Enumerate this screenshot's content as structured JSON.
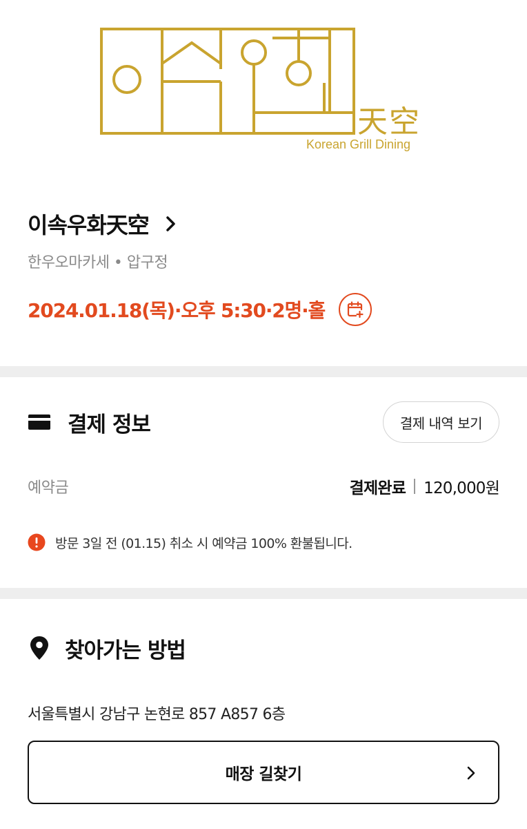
{
  "logo": {
    "hangul_mark": "이속우화",
    "hanja": "天空",
    "tagline": "Korean Grill Dining",
    "color": "#c9a42f"
  },
  "store": {
    "name": "이속우화天空",
    "category": "한우오마카세 • 압구정",
    "reservation": "2024.01.18(목)·오후 5:30·2명·홀",
    "accent_color": "#e24a1f"
  },
  "payment": {
    "title": "결제 정보",
    "history_button": "결제 내역 보기",
    "deposit_label": "예약금",
    "status": "결제완료",
    "amount": "120,000원",
    "notice": "방문 3일 전 (01.15) 취소 시 예약금 100% 환불됩니다."
  },
  "directions": {
    "title": "찾아가는 방법",
    "address": "서울특별시 강남구 논현로 857 A857 6층",
    "button": "매장 길찾기"
  },
  "icons": [
    "chevron-right-icon",
    "calendar-add-icon",
    "card-icon",
    "info-icon",
    "location-pin-icon"
  ]
}
